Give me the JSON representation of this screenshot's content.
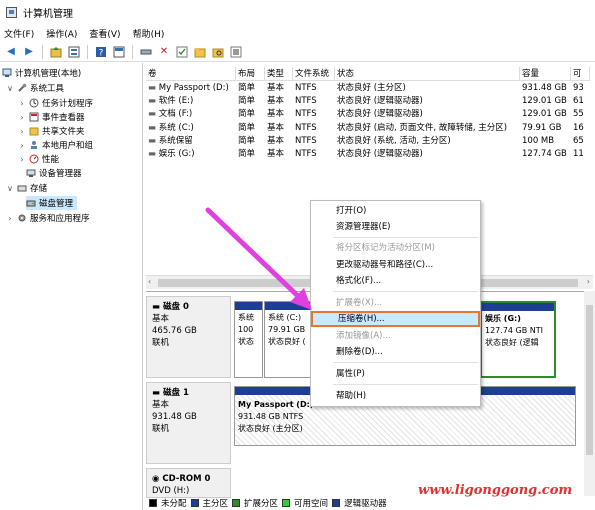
{
  "window": {
    "title": "计算机管理"
  },
  "menu": [
    "文件(F)",
    "操作(A)",
    "查看(V)",
    "帮助(H)"
  ],
  "toolbar": [
    "back-icon",
    "forward-icon",
    "up-icon",
    "properties-icon",
    "help-icon",
    "view-icon",
    "connect-icon",
    "delete-icon",
    "check-icon",
    "folder-icon",
    "folder-search-icon",
    "list-icon"
  ],
  "tree": {
    "root": "计算机管理(本地)",
    "system_tools": "系统工具",
    "task_scheduler": "任务计划程序",
    "event_viewer": "事件查看器",
    "shared_folders": "共享文件夹",
    "local_users": "本地用户和组",
    "performance": "性能",
    "device_manager": "设备管理器",
    "storage": "存储",
    "disk_management": "磁盘管理",
    "services": "服务和应用程序"
  },
  "volume_table": {
    "headers": [
      "卷",
      "布局",
      "类型",
      "文件系统",
      "状态",
      "容量",
      "可"
    ],
    "rows": [
      [
        "My Passport (D:)",
        "简单",
        "基本",
        "NTFS",
        "状态良好 (主分区)",
        "931.48 GB",
        "93"
      ],
      [
        "软件 (E:)",
        "简单",
        "基本",
        "NTFS",
        "状态良好 (逻辑驱动器)",
        "129.01 GB",
        "61"
      ],
      [
        "文档 (F:)",
        "简单",
        "基本",
        "NTFS",
        "状态良好 (逻辑驱动器)",
        "129.01 GB",
        "55"
      ],
      [
        "系统 (C:)",
        "简单",
        "基本",
        "NTFS",
        "状态良好 (启动, 页面文件, 故障转储, 主分区)",
        "79.91 GB",
        "16"
      ],
      [
        "系统保留",
        "简单",
        "基本",
        "NTFS",
        "状态良好 (系统, 活动, 主分区)",
        "100 MB",
        "65"
      ],
      [
        "娱乐 (G:)",
        "简单",
        "基本",
        "NTFS",
        "状态良好 (逻辑驱动器)",
        "127.74 GB",
        "11"
      ]
    ]
  },
  "disks": [
    {
      "name": "磁盘 0",
      "type": "基本",
      "size": "465.76 GB",
      "status": "联机",
      "partitions": [
        {
          "name": "系统",
          "size": "100",
          "status": "状态"
        },
        {
          "name": "系统 (C:)",
          "size": "79.91 GB",
          "status": "状态良好 ("
        },
        {
          "name": "娱乐 (G:)",
          "size": "127.74 GB NTI",
          "status": "状态良好 (逻辑"
        }
      ]
    },
    {
      "name": "磁盘 1",
      "type": "基本",
      "size": "931.48 GB",
      "status": "联机",
      "partitions": [
        {
          "name": "My Passport (D:)",
          "size": "931.48 GB NTFS",
          "status": "状态良好 (主分区)"
        }
      ]
    },
    {
      "name": "CD-ROM 0",
      "type": "DVD (H:)",
      "size": "",
      "status": "",
      "partitions": []
    }
  ],
  "legend": [
    {
      "label": "未分配",
      "color": "#000000"
    },
    {
      "label": "主分区",
      "color": "#1c3f94"
    },
    {
      "label": "扩展分区",
      "color": "#2e8b2e"
    },
    {
      "label": "可用空间",
      "color": "#33cc33"
    },
    {
      "label": "逻辑驱动器",
      "color": "#1c3f94"
    }
  ],
  "context_menu": {
    "items": [
      {
        "label": "打开(O)",
        "enabled": true
      },
      {
        "label": "资源管理器(E)",
        "enabled": true
      },
      {
        "label": "将分区标记为活动分区(M)",
        "enabled": false
      },
      {
        "label": "更改驱动器号和路径(C)...",
        "enabled": true
      },
      {
        "label": "格式化(F)...",
        "enabled": true
      },
      {
        "label": "扩展卷(X)...",
        "enabled": false
      },
      {
        "label": "压缩卷(H)...",
        "enabled": true,
        "highlighted": true
      },
      {
        "label": "添加镜像(A)...",
        "enabled": false
      },
      {
        "label": "删除卷(D)...",
        "enabled": true
      },
      {
        "label": "属性(P)",
        "enabled": true
      },
      {
        "label": "帮助(H)",
        "enabled": true
      }
    ]
  },
  "colors": {
    "accent": "#e8772e",
    "arrow": "#e040e0",
    "primary_partition": "#1c3f94",
    "selection": "#cce8ff"
  },
  "watermark": "www.ligonggong.com"
}
